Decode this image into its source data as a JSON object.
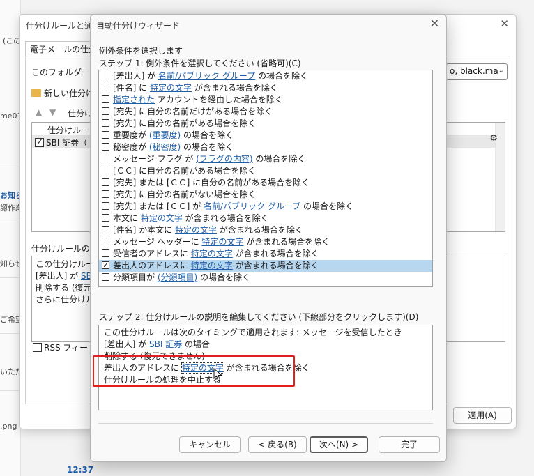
{
  "background": {
    "fragments": [
      "(この",
      "me01,",
      "お知ら",
      "認作業",
      "知らせ",
      "ご希望",
      "いただ",
      ".png",
      "12:37"
    ]
  },
  "rules_dialog": {
    "title": "仕分けルールと通知",
    "tab_label": "電子メールの仕分",
    "folder_label": "このフォルダーに変",
    "select_value": "o, black.ma",
    "new_rule_label": "新しい仕分け",
    "column_label": "仕分け",
    "list_header": "仕分けルール",
    "rule_row": "SBI 証券（",
    "description_label": "仕分けルールの説",
    "desc_lines": [
      {
        "pre": "この仕分けルール",
        "link": "",
        "post": ""
      },
      {
        "pre": "[差出人] が ",
        "link": "SB",
        "post": ""
      },
      {
        "pre": "削除する (復元",
        "link": "",
        "post": ""
      },
      {
        "pre": "  さらに仕分けル",
        "link": "",
        "post": ""
      }
    ],
    "rss_label": "RSS フィードが",
    "apply_label": "適用(A)"
  },
  "wizard": {
    "title": "自動仕分けウィザード",
    "heading": "例外条件を選択します",
    "step1_label": "ステップ 1: 例外条件を選択してください (省略可)(C)",
    "conditions": [
      {
        "checked": false,
        "pre": "[差出人] が ",
        "link": "名前/パブリック グループ",
        "post": " の場合を除く"
      },
      {
        "checked": false,
        "pre": "[件名] に ",
        "link": "特定の文字",
        "post": " が含まれる場合を除く"
      },
      {
        "checked": false,
        "pre": "",
        "link": "指定された",
        "post": " アカウントを経由した場合を除く"
      },
      {
        "checked": false,
        "pre": "[宛先] に自分の名前だけがある場合を除く",
        "link": "",
        "post": ""
      },
      {
        "checked": false,
        "pre": "[宛先] に自分の名前がある場合を除く",
        "link": "",
        "post": ""
      },
      {
        "checked": false,
        "pre": "重要度が ",
        "link": "(重要度)",
        "post": " の場合を除く"
      },
      {
        "checked": false,
        "pre": "秘密度が ",
        "link": "(秘密度)",
        "post": " の場合を除く"
      },
      {
        "checked": false,
        "pre": "メッセージ フラグ が ",
        "link": "(フラグの内容)",
        "post": " の場合を除く"
      },
      {
        "checked": false,
        "pre": "[ＣＣ] に自分の名前がある場合を除く",
        "link": "",
        "post": ""
      },
      {
        "checked": false,
        "pre": "[宛先] または [ＣＣ] に自分の名前がある場合を除く",
        "link": "",
        "post": ""
      },
      {
        "checked": false,
        "pre": "[宛先] に自分の名前がない場合を除く",
        "link": "",
        "post": ""
      },
      {
        "checked": false,
        "pre": "[宛先] または [ＣＣ] が ",
        "link": "名前/パブリック グループ",
        "post": " の場合を除く"
      },
      {
        "checked": false,
        "pre": "本文に ",
        "link": "特定の文字",
        "post": " が含まれる場合を除く"
      },
      {
        "checked": false,
        "pre": "[件名] か本文に ",
        "link": "特定の文字",
        "post": " が含まれる場合を除く"
      },
      {
        "checked": false,
        "pre": "メッセージ ヘッダーに ",
        "link": "特定の文字",
        "post": " が含まれる場合を除く"
      },
      {
        "checked": false,
        "pre": "受信者のアドレスに ",
        "link": "特定の文字",
        "post": " が含まれる場合を除く"
      },
      {
        "checked": true,
        "selected": true,
        "pre": "差出人のアドレスに ",
        "link": "特定の文字",
        "post": " が含まれる場合を除く"
      },
      {
        "checked": false,
        "pre": "分類項目が ",
        "link": "(分類項目)",
        "post": " の場合を除く"
      }
    ],
    "step2_label": "ステップ 2: 仕分けルールの説明を編集してください (下線部分をクリックします)(D)",
    "description": [
      {
        "pre": "この仕分けルールは次のタイミングで適用されます: メッセージを受信したとき",
        "link": "",
        "post": ""
      },
      {
        "pre": "[差出人] が ",
        "link": "SBI 証券",
        "post": " の場合"
      },
      {
        "pre": "削除する (復元できません)",
        "link": "",
        "post": ""
      },
      {
        "pre": "差出人のアドレスに ",
        "link": "特定の文字",
        "post": " が含まれる場合を除く"
      },
      {
        "pre": "仕分けルールの処理を中止する",
        "link": "",
        "post": ""
      }
    ],
    "buttons": {
      "cancel": "キャンセル",
      "back": "< 戻る(B)",
      "next": "次へ(N) >",
      "finish": "完了"
    }
  },
  "colors": {
    "link": "#1f5fa8",
    "selection": "#b7d6ef",
    "highlight_box": "#e02020"
  }
}
